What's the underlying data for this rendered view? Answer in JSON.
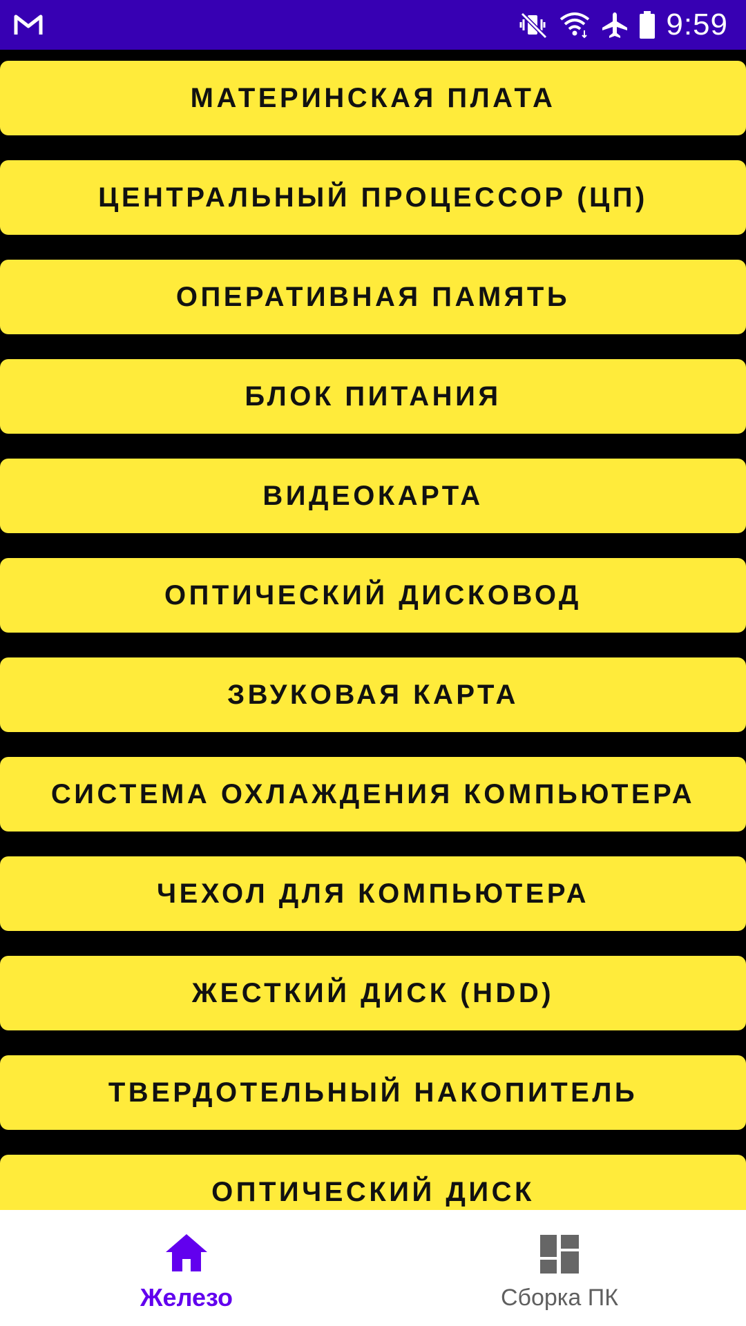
{
  "status_bar": {
    "time": "9:59",
    "icons": [
      "gmail-icon",
      "mute-vibrate-icon",
      "wifi-icon",
      "airplane-icon",
      "battery-icon"
    ]
  },
  "colors": {
    "status_bar": "#3700B3",
    "item_bg": "#FFEB3B",
    "background": "#000000",
    "nav_active": "#6200EE",
    "nav_inactive": "#666666"
  },
  "list": {
    "items": [
      "Материнская плата",
      "Центральный процессор (ЦП)",
      "Оперативная память",
      "Блок питания",
      "Видеокарта",
      "Оптический дисковод",
      "Звуковая карта",
      "Система охлаждения компьютера",
      "Чехол для компьютера",
      "Жесткий диск (HDD)",
      "Твердотельный накопитель",
      "Оптический диск"
    ]
  },
  "bottom_nav": {
    "items": [
      {
        "label": "Железо",
        "icon": "home-icon",
        "active": true
      },
      {
        "label": "Сборка ПК",
        "icon": "dashboard-icon",
        "active": false
      }
    ]
  }
}
